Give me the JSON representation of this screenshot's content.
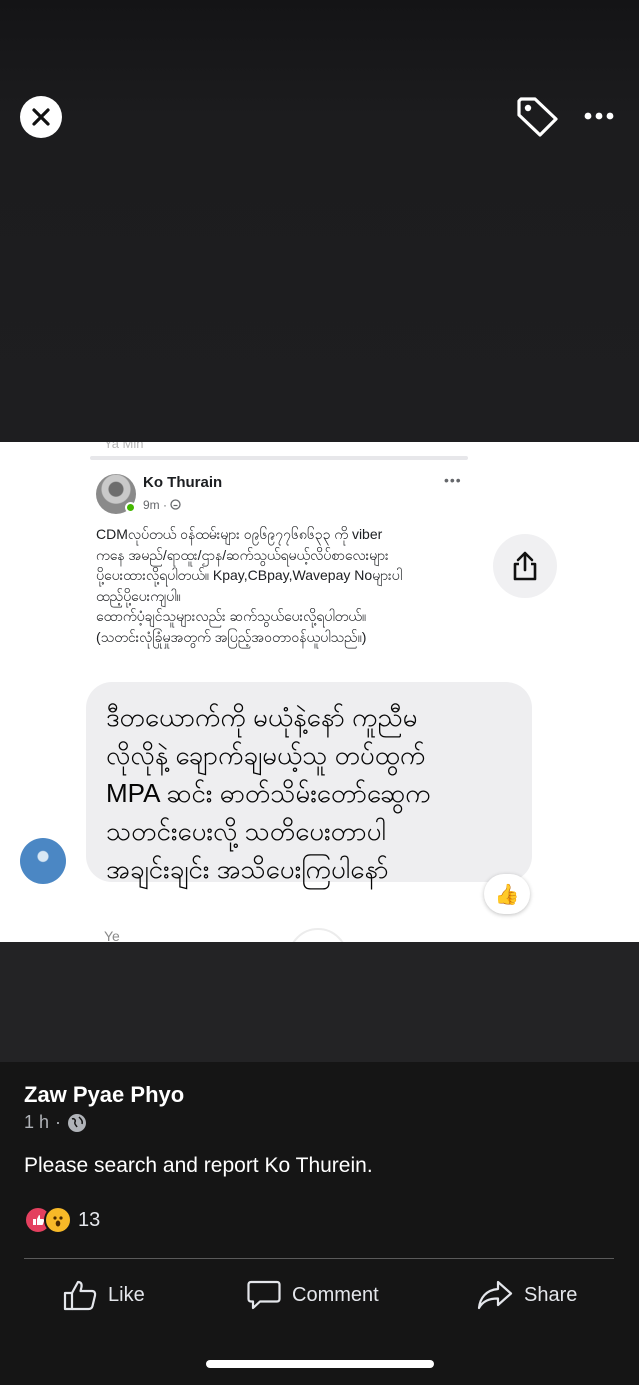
{
  "viewer": {
    "close_icon": "close-icon",
    "tag_icon": "tag-icon",
    "more_icon": "more-dots-icon"
  },
  "screenshot": {
    "faded_top_text": "Ya Min",
    "embedded_post": {
      "author": "Ko Thurain",
      "time": "9m",
      "privacy_icon": "friends-icon",
      "more": "•••",
      "body": "CDMလုပ်တယ် ဝန်ထမ်းများ ၀၉၆၉၇၇၆၈၆၃၃ ကို viber\nကနေ အမည်/ရာထူး/ဌာန/ဆက်သွယ်ရမယ့်လိပ်စာလေးများ\nပို့ပေးထားလို့ရပါတယ်။ Kpay,CBpay,Wavepay Noများပါ\nထည့်ပို့ပေးကျပါ။\nထောက်ပံ့ချင်သူများလည်း ဆက်သွယ်ပေးလို့ရပါတယ်။\n(သတင်းလုံခြုံမှုအတွက် အပြည့်အဝတာဝန်ယူပါသည်။)"
    },
    "share_icon": "share-upload-icon",
    "message": "ဒီတယောက်ကို မယုံနဲ့နော် ကူညီမ\nလိုလိုနဲ့ ချောက်ချမယ့်သူ တပ်ထွက်\nMPA ဆင်း ဓာတ်သိမ်းတော်ဆွေက\nသတင်းပေးလို့ သတိပေးတာပါ\nအချင်းချင်း အသိပေးကြပါနော်",
    "reaction": "👍",
    "faded_bottom_text": "Ye"
  },
  "post": {
    "author": "Zaw Pyae Phyo",
    "time": "1 h",
    "separator": "·",
    "privacy_icon": "globe-icon",
    "caption": "Please search and report Ko Thurein.",
    "reaction_count": "13",
    "reactions": [
      "love-icon",
      "wow-icon"
    ]
  },
  "actions": {
    "like": "Like",
    "comment": "Comment",
    "share": "Share"
  },
  "colors": {
    "background": "#1c1c1e",
    "accent_green": "#44b700",
    "love": "#e4405f",
    "wow": "#f7b928"
  }
}
